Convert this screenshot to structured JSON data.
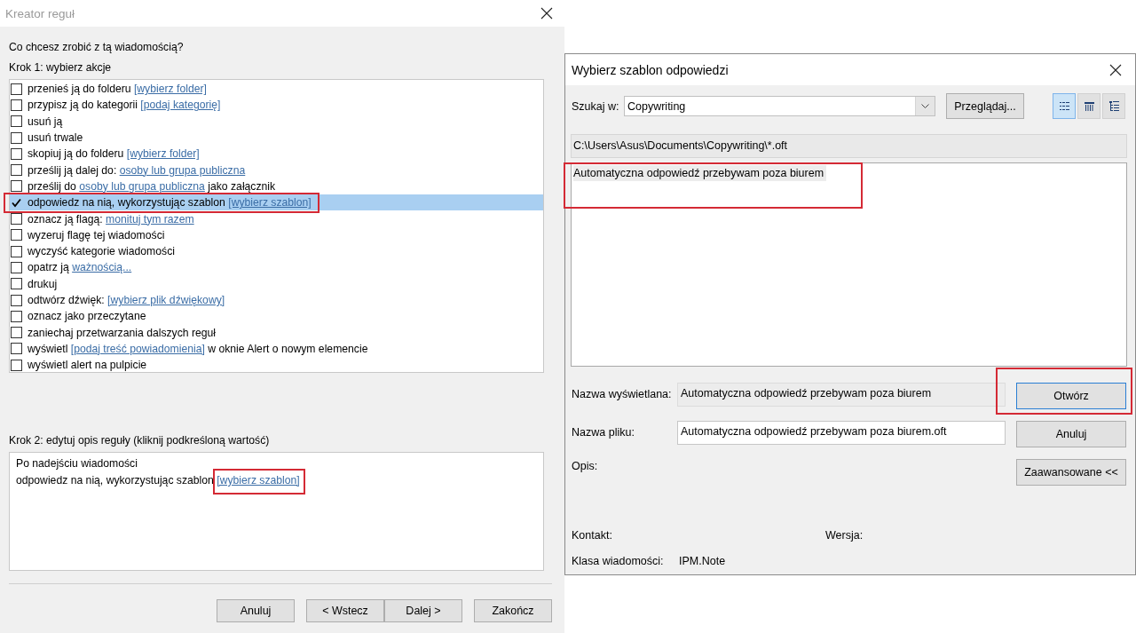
{
  "rule_wizard": {
    "title": "Kreator reguł",
    "active": false,
    "question": "Co chcesz zrobić z tą wiadomością?",
    "step1": "Krok 1: wybierz akcje",
    "actions": [
      {
        "parts": [
          {
            "kind": "text",
            "text": "przenieś ją do folderu"
          },
          {
            "kind": "link",
            "text": "[wybierz folder]"
          }
        ],
        "checked": false,
        "selected": false,
        "annotated": false
      },
      {
        "parts": [
          {
            "kind": "text",
            "text": "przypisz ją do kategorii"
          },
          {
            "kind": "link",
            "text": "[podaj kategorię]"
          }
        ],
        "checked": false,
        "selected": false,
        "annotated": false
      },
      {
        "parts": [
          {
            "kind": "text",
            "text": "usuń ją"
          }
        ],
        "checked": false,
        "selected": false,
        "annotated": false
      },
      {
        "parts": [
          {
            "kind": "text",
            "text": "usuń trwale"
          }
        ],
        "checked": false,
        "selected": false,
        "annotated": false
      },
      {
        "parts": [
          {
            "kind": "text",
            "text": "skopiuj ją do folderu"
          },
          {
            "kind": "link",
            "text": "[wybierz folder]"
          }
        ],
        "checked": false,
        "selected": false,
        "annotated": false
      },
      {
        "parts": [
          {
            "kind": "text",
            "text": "prześlij ją dalej do:"
          },
          {
            "kind": "link",
            "text": "osoby lub grupa publiczna"
          }
        ],
        "checked": false,
        "selected": false,
        "annotated": false
      },
      {
        "parts": [
          {
            "kind": "text",
            "text": "prześlij do"
          },
          {
            "kind": "link",
            "text": "osoby lub grupa publiczna"
          },
          {
            "kind": "text",
            "text": "jako załącznik"
          }
        ],
        "checked": false,
        "selected": false,
        "annotated": false
      },
      {
        "parts": [
          {
            "kind": "text",
            "text": "odpowiedz na nią, wykorzystując szablon"
          },
          {
            "kind": "link",
            "text": "[wybierz szablon]"
          }
        ],
        "checked": true,
        "selected": true,
        "annotated": true
      },
      {
        "parts": [
          {
            "kind": "text",
            "text": "oznacz ją flagą:"
          },
          {
            "kind": "link",
            "text": "monituj tym razem"
          }
        ],
        "checked": false,
        "selected": false,
        "annotated": false
      },
      {
        "parts": [
          {
            "kind": "text",
            "text": "wyzeruj flagę tej wiadomości"
          }
        ],
        "checked": false,
        "selected": false,
        "annotated": false
      },
      {
        "parts": [
          {
            "kind": "text",
            "text": "wyczyść kategorie wiadomości"
          }
        ],
        "checked": false,
        "selected": false,
        "annotated": false
      },
      {
        "parts": [
          {
            "kind": "text",
            "text": "opatrz ją"
          },
          {
            "kind": "link",
            "text": "ważnością..."
          }
        ],
        "checked": false,
        "selected": false,
        "annotated": false
      },
      {
        "parts": [
          {
            "kind": "text",
            "text": "drukuj"
          }
        ],
        "checked": false,
        "selected": false,
        "annotated": false
      },
      {
        "parts": [
          {
            "kind": "text",
            "text": "odtwórz dźwięk:"
          },
          {
            "kind": "link",
            "text": "[wybierz plik dźwiękowy]"
          }
        ],
        "checked": false,
        "selected": false,
        "annotated": false
      },
      {
        "parts": [
          {
            "kind": "text",
            "text": "oznacz jako przeczytane"
          }
        ],
        "checked": false,
        "selected": false,
        "annotated": false
      },
      {
        "parts": [
          {
            "kind": "text",
            "text": "zaniechaj przetwarzania dalszych reguł"
          }
        ],
        "checked": false,
        "selected": false,
        "annotated": false
      },
      {
        "parts": [
          {
            "kind": "text",
            "text": "wyświetl"
          },
          {
            "kind": "link",
            "text": "[podaj treść powiadomienia]"
          },
          {
            "kind": "text",
            "text": "w oknie Alert o nowym elemencie"
          }
        ],
        "checked": false,
        "selected": false,
        "annotated": false
      },
      {
        "parts": [
          {
            "kind": "text",
            "text": "wyświetl alert na pulpicie"
          }
        ],
        "checked": false,
        "selected": false,
        "annotated": false
      }
    ],
    "step2": "Krok 2: edytuj opis reguły (kliknij podkreśloną wartość)",
    "description": [
      {
        "parts": [
          {
            "kind": "text",
            "text": "Po nadejściu wiadomości",
            "annotated": false
          }
        ]
      },
      {
        "parts": [
          {
            "kind": "text",
            "text": "odpowiedz na nią, wykorzystując szablon",
            "annotated": false
          },
          {
            "kind": "link",
            "text": "[wybierz szablon]",
            "annotated": true
          }
        ]
      }
    ],
    "button_groups": [
      {
        "buttons": [
          {
            "label": "Anuluj"
          }
        ]
      },
      {
        "buttons": [
          {
            "label": "< Wstecz"
          },
          {
            "label": "Dalej >"
          }
        ]
      },
      {
        "buttons": [
          {
            "label": "Zakończ"
          }
        ]
      }
    ]
  },
  "template_dialog": {
    "title": "Wybierz szablon odpowiedzi",
    "active": true,
    "look_in": {
      "label": "Szukaj w:",
      "value": "Copywriting"
    },
    "browse_button": "Przeglądaj...",
    "view_buttons": [
      {
        "kind": "details",
        "selected": true
      },
      {
        "kind": "columns",
        "selected": false
      },
      {
        "kind": "tree",
        "selected": false
      }
    ],
    "path": {
      "value": "C:\\Users\\Asus\\Documents\\Copywriting\\*.oft",
      "disabled": true
    },
    "templates": [
      {
        "name": "Automatyczna odpowiedź przebywam poza biurem",
        "selected": true,
        "annotated": true
      }
    ],
    "name_fields": [
      {
        "label": "Nazwa wyświetlana:",
        "value": "Automatyczna odpowiedź przebywam poza biurem",
        "disabled": true
      },
      {
        "label": "Nazwa pliku:",
        "value": "Automatyczna odpowiedź przebywam poza biurem.oft",
        "disabled": false
      }
    ],
    "description_label": "Opis:",
    "buttons": [
      {
        "label": "Otwórz",
        "default": true,
        "annotated": true
      },
      {
        "label": "Anuluj",
        "default": false,
        "annotated": false
      },
      {
        "label": "Zaawansowane <<",
        "default": false,
        "annotated": false
      }
    ],
    "property_rows": [
      {
        "items": [
          {
            "label": "Kontakt:"
          },
          {
            "label": "Wersja:"
          }
        ]
      },
      {
        "items": [
          {
            "label": "Klasa wiadomości:",
            "value": "IPM.Note"
          }
        ]
      }
    ]
  }
}
